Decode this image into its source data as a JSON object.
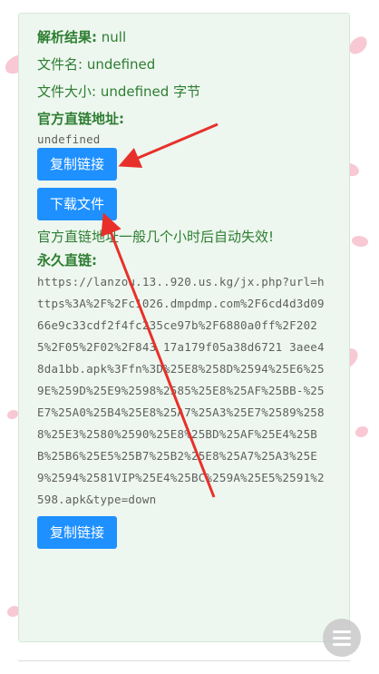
{
  "result": {
    "parse_label": "解析结果:",
    "parse_value": " null",
    "filename_label": "文件名:",
    "filename_value": " undefined",
    "filesize_label": "文件大小:",
    "filesize_value": " undefined 字节",
    "official_link_label": "官方直链地址:",
    "official_link_value": "undefined",
    "copy_button": "复制链接",
    "download_button": "下载文件",
    "expire_notice": "官方直链地址一般几个小时后自动失效!",
    "permanent_label": "永久直链:",
    "permanent_url": "https://lanzou.13..920.us.kg/jx.php?url=https%3A%2F%2Fc1026.dmpdmp.com%2F6cd4d3d0966e9c33cdf2f4fc235ce97b%2F6880a0ff%2F2025%2F05%2F02%2F843 17a179f05a38d6721 3aee48da1bb.apk%3Ffn%3D%25E8%258D%2594%25E6%259E%259D%25E9%2598%2585%25E8%25AF%25BB-%25E7%25A0%25B4%25E8%25A7%25A3%25E7%2589%2588%25E3%2580%2590%25E8%25BD%25AF%25E4%25BB%25B6%25E5%25B7%25B2%25E8%25A7%25A3%25E9%2594%2581VIP%25E4%25BC%259A%25E5%2591%2598.apk&type=down",
    "copy_button_2": "复制链接"
  },
  "fab_icon": "menu-icon",
  "colors": {
    "accent": "#1e90ff",
    "label": "#2e7d32",
    "card_bg": "#edf7ef",
    "arrow": "#e8302b"
  }
}
